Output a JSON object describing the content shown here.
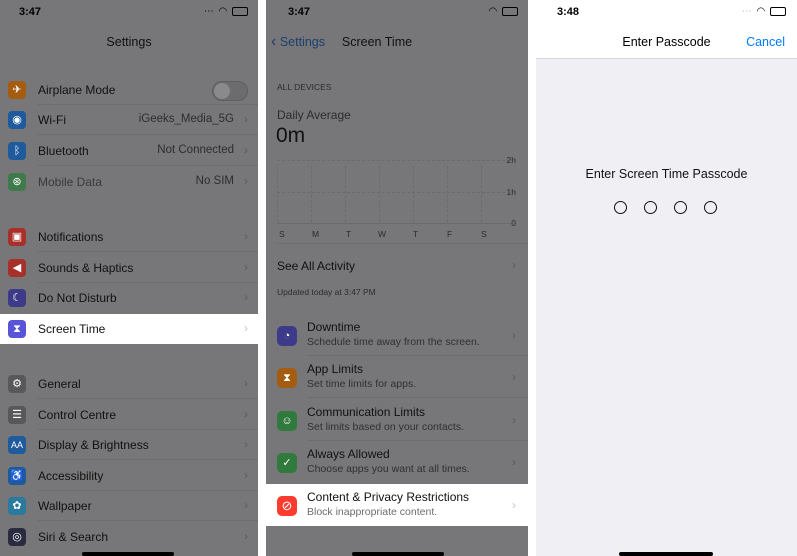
{
  "colors": {
    "accent": "#007aff",
    "dim_background": "#777779",
    "highlight": "#ffffff"
  },
  "settings": {
    "time": "3:47",
    "title": "Settings",
    "group1": [
      {
        "label": "Airplane Mode",
        "icon": "airplane-icon",
        "color": "#a45c10"
      },
      {
        "label": "Wi-Fi",
        "value": "iGeeks_Media_5G",
        "icon": "wifi-icon",
        "color": "#1e5a9c"
      },
      {
        "label": "Bluetooth",
        "value": "Not Connected",
        "icon": "bluetooth-icon",
        "color": "#1e5a9c"
      },
      {
        "label": "Mobile Data",
        "value": "No SIM",
        "icon": "antenna-icon",
        "color": "#3f7a4a"
      }
    ],
    "group2": [
      {
        "label": "Notifications",
        "icon": "notifications-icon",
        "color": "#a8302a"
      },
      {
        "label": "Sounds & Haptics",
        "icon": "speaker-icon",
        "color": "#a8302a"
      },
      {
        "label": "Do Not Disturb",
        "icon": "moon-icon",
        "color": "#3e3a8a"
      },
      {
        "label": "Screen Time",
        "icon": "hourglass-icon",
        "color": "#5856d6"
      }
    ],
    "group3": [
      {
        "label": "General",
        "icon": "gear-icon",
        "color": "#58585a"
      },
      {
        "label": "Control Centre",
        "icon": "control-centre-icon",
        "color": "#58585a"
      },
      {
        "label": "Display & Brightness",
        "icon": "display-icon",
        "color": "#1e5a9c"
      },
      {
        "label": "Accessibility",
        "icon": "accessibility-icon",
        "color": "#1e5a9c"
      },
      {
        "label": "Wallpaper",
        "icon": "wallpaper-icon",
        "color": "#2a7aa0"
      },
      {
        "label": "Siri & Search",
        "icon": "siri-icon",
        "color": "#2a2a40"
      }
    ]
  },
  "screen_time": {
    "time": "3:47",
    "back_label": "Settings",
    "title": "Screen Time",
    "section_header": "ALL DEVICES",
    "daily_average_label": "Daily Average",
    "daily_average_value": "0m",
    "chart_ticks": [
      "2h",
      "1h",
      "0"
    ],
    "chart_days": [
      "S",
      "M",
      "T",
      "W",
      "T",
      "F",
      "S"
    ],
    "see_all_label": "See All Activity",
    "updated_label": "Updated today at 3:47 PM",
    "items": [
      {
        "title": "Downtime",
        "subtitle": "Schedule time away from the screen.",
        "icon": "downtime-icon",
        "color": "#3e3a8a"
      },
      {
        "title": "App Limits",
        "subtitle": "Set time limits for apps.",
        "icon": "hourglass-icon",
        "color": "#a45c10"
      },
      {
        "title": "Communication Limits",
        "subtitle": "Set limits based on your contacts.",
        "icon": "contacts-icon",
        "color": "#2f7a3c"
      },
      {
        "title": "Always Allowed",
        "subtitle": "Choose apps you want at all times.",
        "icon": "checkmark-icon",
        "color": "#2f7a3c"
      },
      {
        "title": "Content & Privacy Restrictions",
        "subtitle": "Block inappropriate content.",
        "icon": "restrictions-icon",
        "color": "#ff3b30"
      }
    ]
  },
  "passcode": {
    "time": "3:48",
    "title": "Enter Passcode",
    "cancel_label": "Cancel",
    "prompt": "Enter Screen Time Passcode"
  }
}
